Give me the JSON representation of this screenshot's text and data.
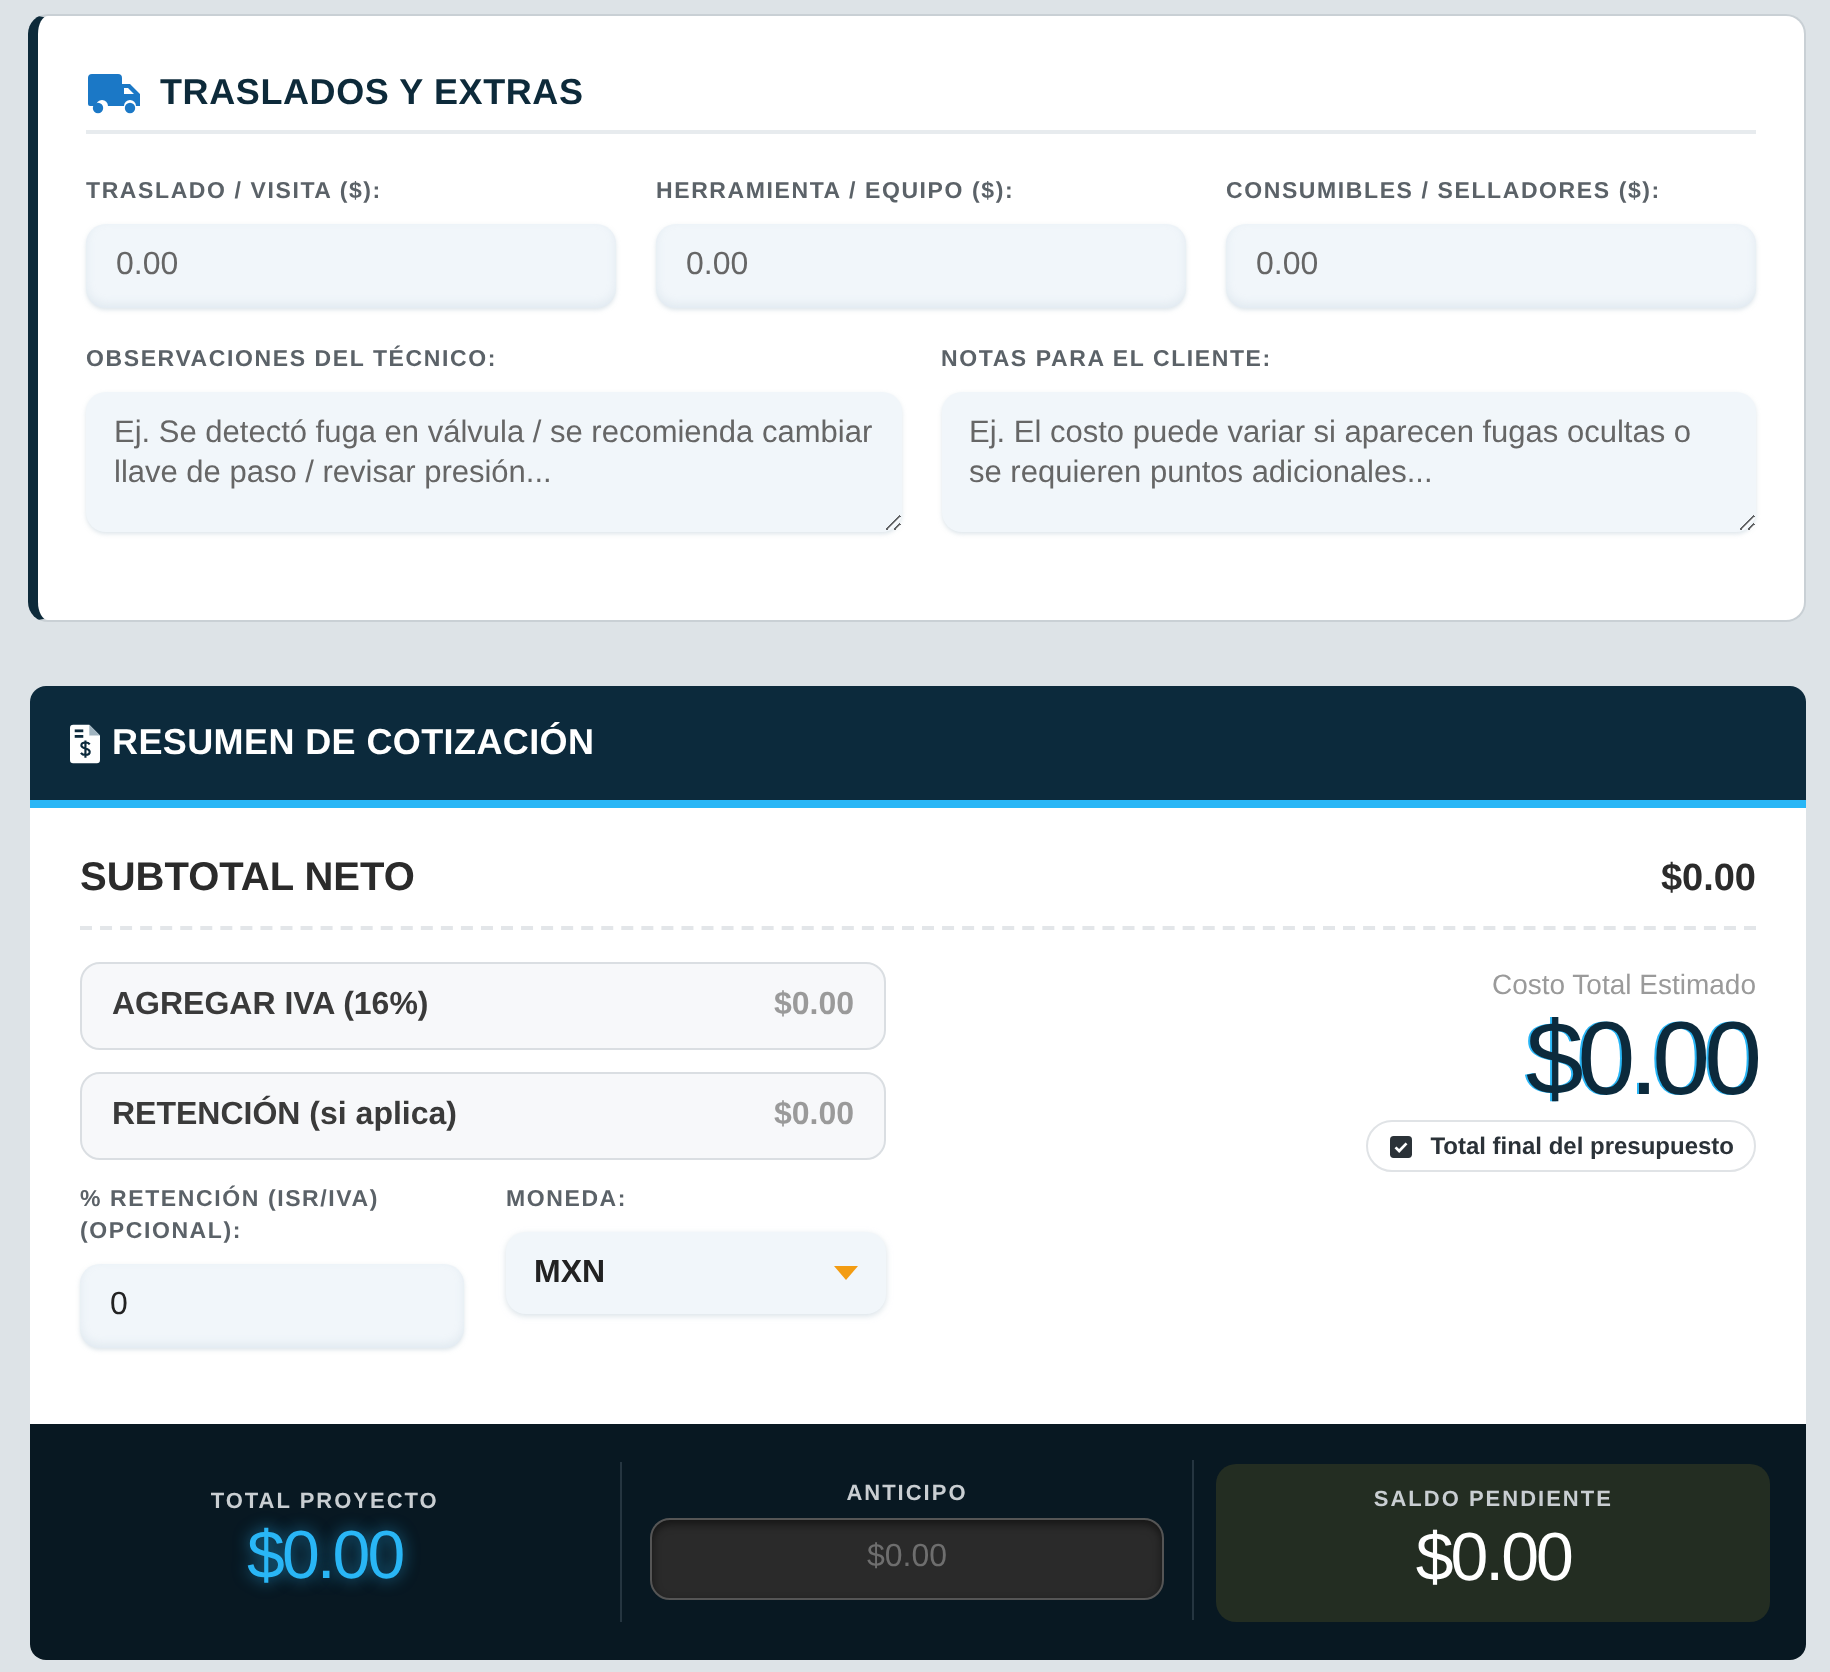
{
  "extras_card": {
    "title": "TRASLADOS Y EXTRAS",
    "fields": [
      {
        "label": "TRASLADO / VISITA ($):",
        "placeholder": "0.00"
      },
      {
        "label": "HERRAMIENTA / EQUIPO ($):",
        "placeholder": "0.00"
      },
      {
        "label": "CONSUMIBLES / SELLADORES ($):",
        "placeholder": "0.00"
      }
    ],
    "notes": [
      {
        "label": "OBSERVACIONES DEL TÉCNICO:",
        "placeholder": "Ej. Se detectó fuga en válvula / se recomienda cambiar llave de paso / revisar presión..."
      },
      {
        "label": "NOTAS PARA EL CLIENTE:",
        "placeholder": "Ej. El costo puede variar si aparecen fugas ocultas o se requieren puntos adicionales..."
      }
    ]
  },
  "summary_card": {
    "title": "RESUMEN DE COTIZACIÓN",
    "subtotal": {
      "label": "SUBTOTAL NETO",
      "value": "$0.00"
    },
    "adjustments": [
      {
        "label": "AGREGAR IVA (16%)",
        "value": "$0.00"
      },
      {
        "label": "RETENCIÓN (si aplica)",
        "value": "$0.00"
      }
    ],
    "retention_field": {
      "label": "% RETENCIÓN (ISR/IVA) (OPCIONAL):",
      "value": "0"
    },
    "currency_select": {
      "label": "MONEDA:",
      "value": "MXN"
    },
    "estimate": {
      "label": "Costo Total Estimado",
      "value": "$0.00",
      "badge": {
        "label": "Total final del presupuesto",
        "checked": true
      }
    }
  },
  "footer": [
    {
      "kind": "total",
      "label": "TOTAL PROYECTO",
      "value": "$0.00"
    },
    {
      "kind": "input",
      "label": "ANTICIPO",
      "placeholder": "$0.00"
    },
    {
      "kind": "balance",
      "label": "SALDO PENDIENTE",
      "value": "$0.00"
    }
  ]
}
